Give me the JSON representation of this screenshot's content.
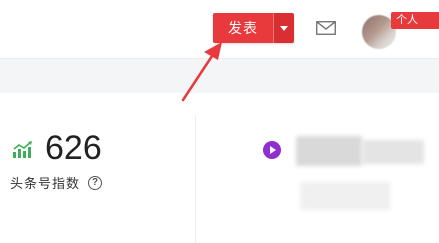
{
  "header": {
    "publish_button": {
      "label": "发表",
      "color": "#e8393c"
    },
    "publish_menu": {
      "icon": "caret-down-icon"
    },
    "messages": {
      "icon": "mail-icon"
    },
    "avatar": {
      "icon": "avatar"
    },
    "personal_badge": {
      "label": "个人"
    }
  },
  "stats": {
    "index": {
      "icon": "trend-chart-icon",
      "value": "626",
      "label": "头条号指数",
      "help_icon": "question-icon"
    },
    "video": {
      "icon": "play-circle-icon",
      "color": "#8e2fd0"
    }
  },
  "annotation": {
    "arrow_color": "#e8393c"
  }
}
